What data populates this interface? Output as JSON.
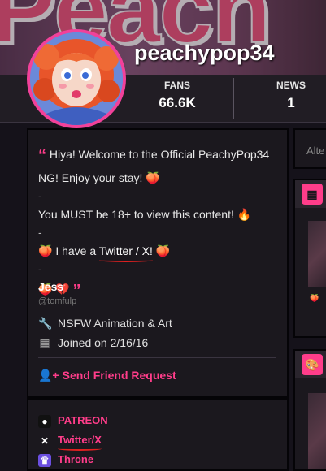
{
  "profile": {
    "username": "peachypop34",
    "stats": [
      {
        "label": "FANS",
        "value": "66.6K"
      },
      {
        "label": "NEWS",
        "value": "1"
      }
    ]
  },
  "banner": {
    "text": "Peach"
  },
  "bio": {
    "line1": "Hiya! Welcome to the Official PeachyPop34 NG! Enjoy your stay! 🍑",
    "dash1": "-",
    "line2": "You MUST be 18+ to view this content! 🔥",
    "dash2": "-",
    "line3_prefix": "🍑 I have a",
    "line3_link": "Twitter / X!",
    "line3_suffix": "🍑",
    "dash3": "-",
    "line4": "🍑 💔",
    "open_quote": "“",
    "close_quote": "”"
  },
  "user": {
    "name": "Jess",
    "handle": "@tomfulp",
    "role": "NSFW Animation & Art",
    "joined": "Joined on 2/16/16",
    "friend_request": "Send Friend Request"
  },
  "links": [
    {
      "label": "PATREON",
      "icon": "patreon-icon"
    },
    {
      "label": "Twitter/X",
      "icon": "x-icon"
    },
    {
      "label": "Throne",
      "icon": "throne-icon"
    }
  ],
  "sidebar": {
    "search_placeholder": "Alte",
    "badge": "🍑"
  },
  "colors": {
    "accent": "#ff3d8a",
    "background": "#15121a",
    "card": "#1b181e"
  }
}
